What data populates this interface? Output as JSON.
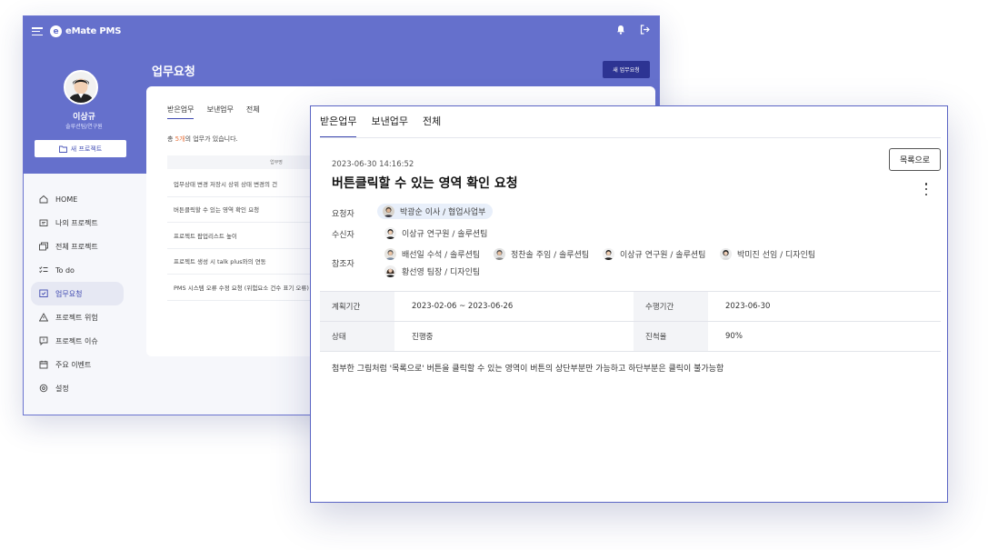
{
  "back_window": {
    "brand": "eMate PMS",
    "profile": {
      "name": "이상규",
      "role": "솔루션팀/연구원",
      "new_project_label": "새 프로젝트"
    },
    "nav": [
      {
        "label": "HOME",
        "icon": "home-icon"
      },
      {
        "label": "나의 프로젝트",
        "icon": "folder-icon"
      },
      {
        "label": "전체 프로젝트",
        "icon": "folders-icon"
      },
      {
        "label": "To do",
        "icon": "checklist-icon"
      },
      {
        "label": "업무요청",
        "icon": "request-icon",
        "active": true
      },
      {
        "label": "프로젝트 위험",
        "icon": "warning-icon"
      },
      {
        "label": "프로젝트 이슈",
        "icon": "issue-icon"
      },
      {
        "label": "주요 이벤트",
        "icon": "calendar-icon"
      },
      {
        "label": "설정",
        "icon": "gear-icon"
      }
    ],
    "page_title": "업무요청",
    "new_request_label": "새 업무요청",
    "tabs": [
      "받은업무",
      "보낸업무",
      "전체"
    ],
    "count_prefix": "총 ",
    "count_num": "5개",
    "count_suffix": "의 업무가 있습니다.",
    "table_header": "업무명",
    "rows": [
      "업무상태 변경 저장시 상위 상태 변경의 건",
      "버튼클릭할 수 있는 영역 확인 요청",
      "프로젝트 팝업리스트 높이",
      "프로젝트 생성 시 talk plus와의 연동",
      "PMS 시스템 오류 수정 요청 (위험요소 건수 표기 오류)"
    ]
  },
  "front_window": {
    "tabs": [
      "받은업무",
      "보낸업무",
      "전체"
    ],
    "back_button_label": "목록으로",
    "datetime": "2023-06-30 14:16:52",
    "title": "버튼클릭할 수 있는 영역 확인 요청",
    "requester_label": "요청자",
    "requester": "박광순 이사 / 협업사업부",
    "receiver_label": "수신자",
    "receiver": "이상규 연구원 / 솔루션팀",
    "cc_label": "참조자",
    "cc": [
      "배선일 수석 / 솔루션팀",
      "정찬솔 주임 / 솔루션팀",
      "이상규 연구원 / 솔루션팀",
      "박미진 선임 / 디자인팀",
      "황선영 팀장 / 디자인팀"
    ],
    "info": {
      "plan_label": "계획기간",
      "plan_value": "2023-02-06 ~ 2023-06-26",
      "exec_label": "수행기간",
      "exec_value": "2023-06-30",
      "status_label": "상태",
      "status_value": "진행중",
      "progress_label": "진척율",
      "progress_value": "90%"
    },
    "description": "첨부한 그림처럼 '목록으로' 버튼을 클릭할 수 있는 영역이 버튼의 상단부분만 가능하고 하단부분은 클릭이 불가능함"
  }
}
